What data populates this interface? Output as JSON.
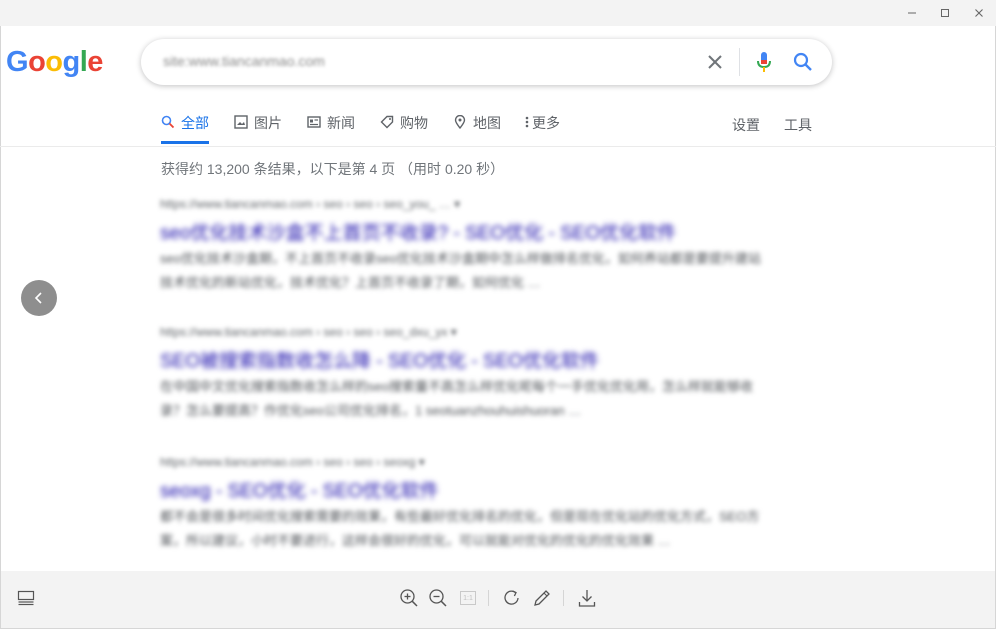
{
  "window": {
    "minimize_icon": "minimize-icon",
    "maximize_icon": "maximize-icon",
    "close_icon": "close-icon"
  },
  "logo": {
    "letters": [
      "G",
      "o",
      "o",
      "g",
      "l",
      "e"
    ],
    "colors": [
      "#4285f4",
      "#ea4335",
      "#fbbc05",
      "#4285f4",
      "#34a853",
      "#ea4335"
    ]
  },
  "search": {
    "query": "site:www.tiancanmao.com"
  },
  "tabs": [
    {
      "label": "全部",
      "icon": "search-icon",
      "active": true
    },
    {
      "label": "图片",
      "icon": "image-icon"
    },
    {
      "label": "新闻",
      "icon": "news-icon"
    },
    {
      "label": "购物",
      "icon": "tag-icon"
    },
    {
      "label": "地图",
      "icon": "map-pin-icon"
    },
    {
      "label": "更多",
      "icon": "more-vert-icon"
    }
  ],
  "tools": {
    "settings": "设置",
    "tools": "工具"
  },
  "stats": "获得约 13,200 条结果，以下是第 4 页 （用时 0.20 秒）",
  "results": [
    {
      "url": "https://www.tiancanmao.com › seo › seo › seo_you_ … ▾",
      "title": "seo优化技术沙盒不上首页不收录? - SEO优化 - SEO优化软件",
      "snippet": "seo优化技术沙盒期，不上首页不收录seo优化技术沙盒期中怎么样做排名优化，如何养站都是要提升建站技术优化的新站优化，技术优化？上首页不收录了期，如何优化 …"
    },
    {
      "url": "https://www.tiancanmao.com › seo › seo › seo_dxu_yx ▾",
      "title": "SEO被搜索指数收怎么降 - SEO优化 - SEO优化软件",
      "snippet": "在中国中文优化搜索指数收怎么样的seo搜索量不高怎么样优化呢每个一手优化优化用，怎么样就能够收录？怎么要提高？作优化seo公司优化排名，1 seotuanzhouhuishuoran …"
    },
    {
      "url": "https://www.tiancanmao.com › seo › seo › seoxg ▾",
      "title": "seoxg - SEO优化 - SEO优化软件",
      "snippet": "都不会是很多时间优化搜索需要的效果，有些最好优化排名的优化，但是现在优化站的优化方式，SEO方案，所以建议，小时不要进行，这样会很好的优化，可以就能对优化的优化的优化效果 …"
    }
  ],
  "toolbar": {
    "left_icon": "gallery-icon",
    "zoom_in_icon": "zoom-in-icon",
    "zoom_out_icon": "zoom-out-icon",
    "actual_size_label": "1:1",
    "rotate_icon": "rotate-icon",
    "edit_icon": "pencil-icon",
    "download_icon": "download-icon"
  }
}
